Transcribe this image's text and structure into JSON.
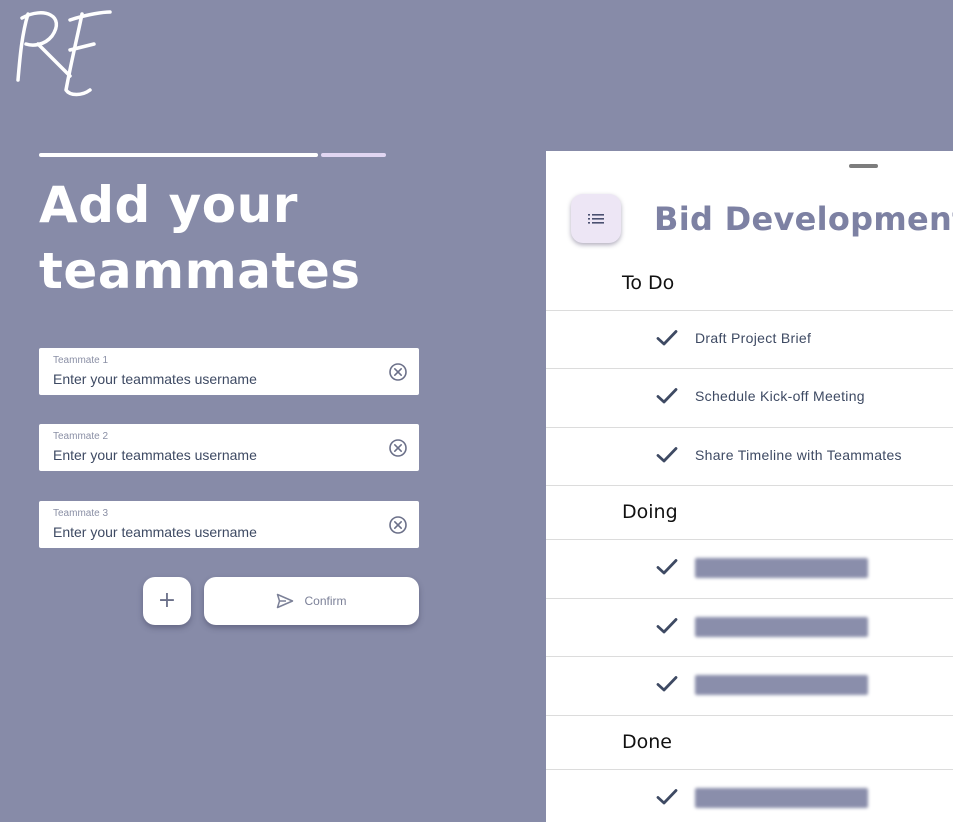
{
  "brand": {
    "logo_text": "RF"
  },
  "form": {
    "heading_line1": "Add your",
    "heading_line2": "teammates",
    "fields": [
      {
        "label": "Teammate 1",
        "placeholder": "Enter your teammates username"
      },
      {
        "label": "Teammate 2",
        "placeholder": "Enter your teammates username"
      },
      {
        "label": "Teammate 3",
        "placeholder": "Enter your teammates username"
      }
    ],
    "add_label": "+",
    "confirm_label": "Confirm"
  },
  "board": {
    "title": "Bid Development",
    "sections": [
      {
        "title": "To Do",
        "items": [
          "Draft Project Brief",
          "Schedule Kick-off Meeting",
          "Share Timeline with Teammates"
        ]
      },
      {
        "title": "Doing",
        "items": [
          "",
          "",
          ""
        ]
      },
      {
        "title": "Done",
        "items": [
          ""
        ]
      }
    ]
  },
  "colors": {
    "background": "#878ba8",
    "accent": "#7d81a3",
    "check": "#3e4a63",
    "progress_active": "#ffffff",
    "progress_inactive": "#e1d6f2"
  },
  "icons": {
    "menu": "list-icon",
    "clear": "clear-circle-icon",
    "send": "send-icon",
    "check": "check-icon"
  }
}
